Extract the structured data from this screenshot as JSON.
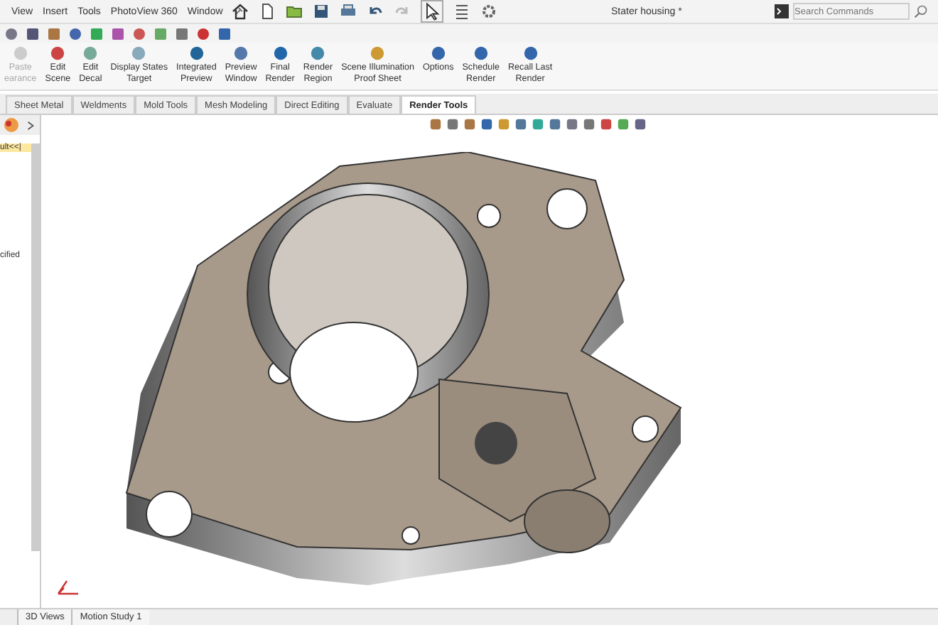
{
  "menu": [
    "View",
    "Insert",
    "Tools",
    "PhotoView 360",
    "Window"
  ],
  "document_title": "Stater housing *",
  "search": {
    "placeholder": "Search Commands"
  },
  "ribbon_buttons": [
    {
      "lines": [
        "Paste",
        "earance"
      ],
      "disabled": true
    },
    {
      "lines": [
        "Edit",
        "Scene"
      ],
      "disabled": false
    },
    {
      "lines": [
        "Edit",
        "Decal"
      ],
      "disabled": false
    },
    {
      "lines": [
        "Display States",
        "Target"
      ],
      "disabled": false
    },
    {
      "lines": [
        "Integrated",
        "Preview"
      ],
      "disabled": false
    },
    {
      "lines": [
        "Preview",
        "Window"
      ],
      "disabled": false
    },
    {
      "lines": [
        "Final",
        "Render"
      ],
      "disabled": false
    },
    {
      "lines": [
        "Render",
        "Region"
      ],
      "disabled": false
    },
    {
      "lines": [
        "Scene Illumination",
        "Proof Sheet"
      ],
      "disabled": false
    },
    {
      "lines": [
        "Options"
      ],
      "disabled": false
    },
    {
      "lines": [
        "Schedule",
        "Render"
      ],
      "disabled": false
    },
    {
      "lines": [
        "Recall Last",
        "Render"
      ],
      "disabled": false
    }
  ],
  "tabs": [
    {
      "label": "Sheet Metal",
      "selected": false
    },
    {
      "label": "Weldments",
      "selected": false
    },
    {
      "label": "Mold Tools",
      "selected": false
    },
    {
      "label": "Mesh Modeling",
      "selected": false
    },
    {
      "label": "Direct Editing",
      "selected": false
    },
    {
      "label": "Evaluate",
      "selected": false
    },
    {
      "label": "Render Tools",
      "selected": true
    }
  ],
  "side_panel": {
    "config_label": "ult<<|",
    "item_text": "cified"
  },
  "bottom_tabs": [
    {
      "label": "3D Views",
      "selected": false
    },
    {
      "label": "Motion Study 1",
      "selected": false
    }
  ]
}
